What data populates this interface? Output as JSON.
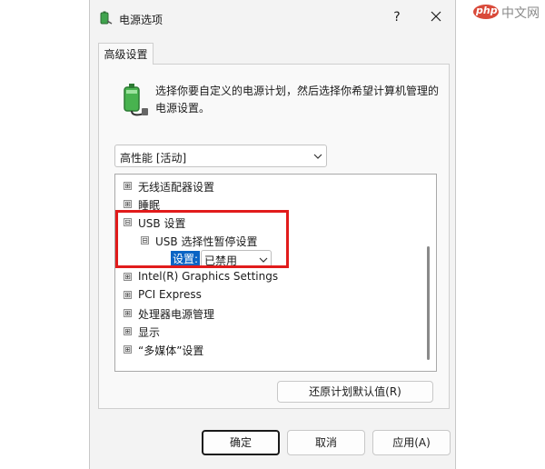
{
  "window": {
    "title": "电源选项",
    "help_glyph": "?",
    "close_glyph": "×"
  },
  "tab": {
    "label": "高级设置"
  },
  "description": "选择你要自定义的电源计划，然后选择你希望计算机管理的电源设置。",
  "plan_select": {
    "value": "高性能 [活动]"
  },
  "tree": {
    "rows": [
      {
        "label": "无线适配器设置",
        "expander": "⊞"
      },
      {
        "label": "睡眠",
        "expander": "⊞"
      },
      {
        "label": "USB 设置",
        "expander": "⊟"
      },
      {
        "label": "USB 选择性暂停设置",
        "expander": "⊟"
      },
      {
        "setting_label": "设置:",
        "setting_value": "已禁用"
      },
      {
        "label": "Intel(R) Graphics Settings",
        "expander": "⊞"
      },
      {
        "label": "PCI Express",
        "expander": "⊞"
      },
      {
        "label": "处理器电源管理",
        "expander": "⊞"
      },
      {
        "label": "显示",
        "expander": "⊞"
      },
      {
        "label": "“多媒体”设置",
        "expander": "⊞"
      }
    ]
  },
  "buttons": {
    "restore": "还原计划默认值(R)",
    "ok": "确定",
    "cancel": "取消",
    "apply": "应用(A)"
  },
  "watermark": {
    "text": "中文网",
    "badge": "php"
  },
  "colors": {
    "highlight": "#e11b1b",
    "selection": "#0a64c4"
  }
}
